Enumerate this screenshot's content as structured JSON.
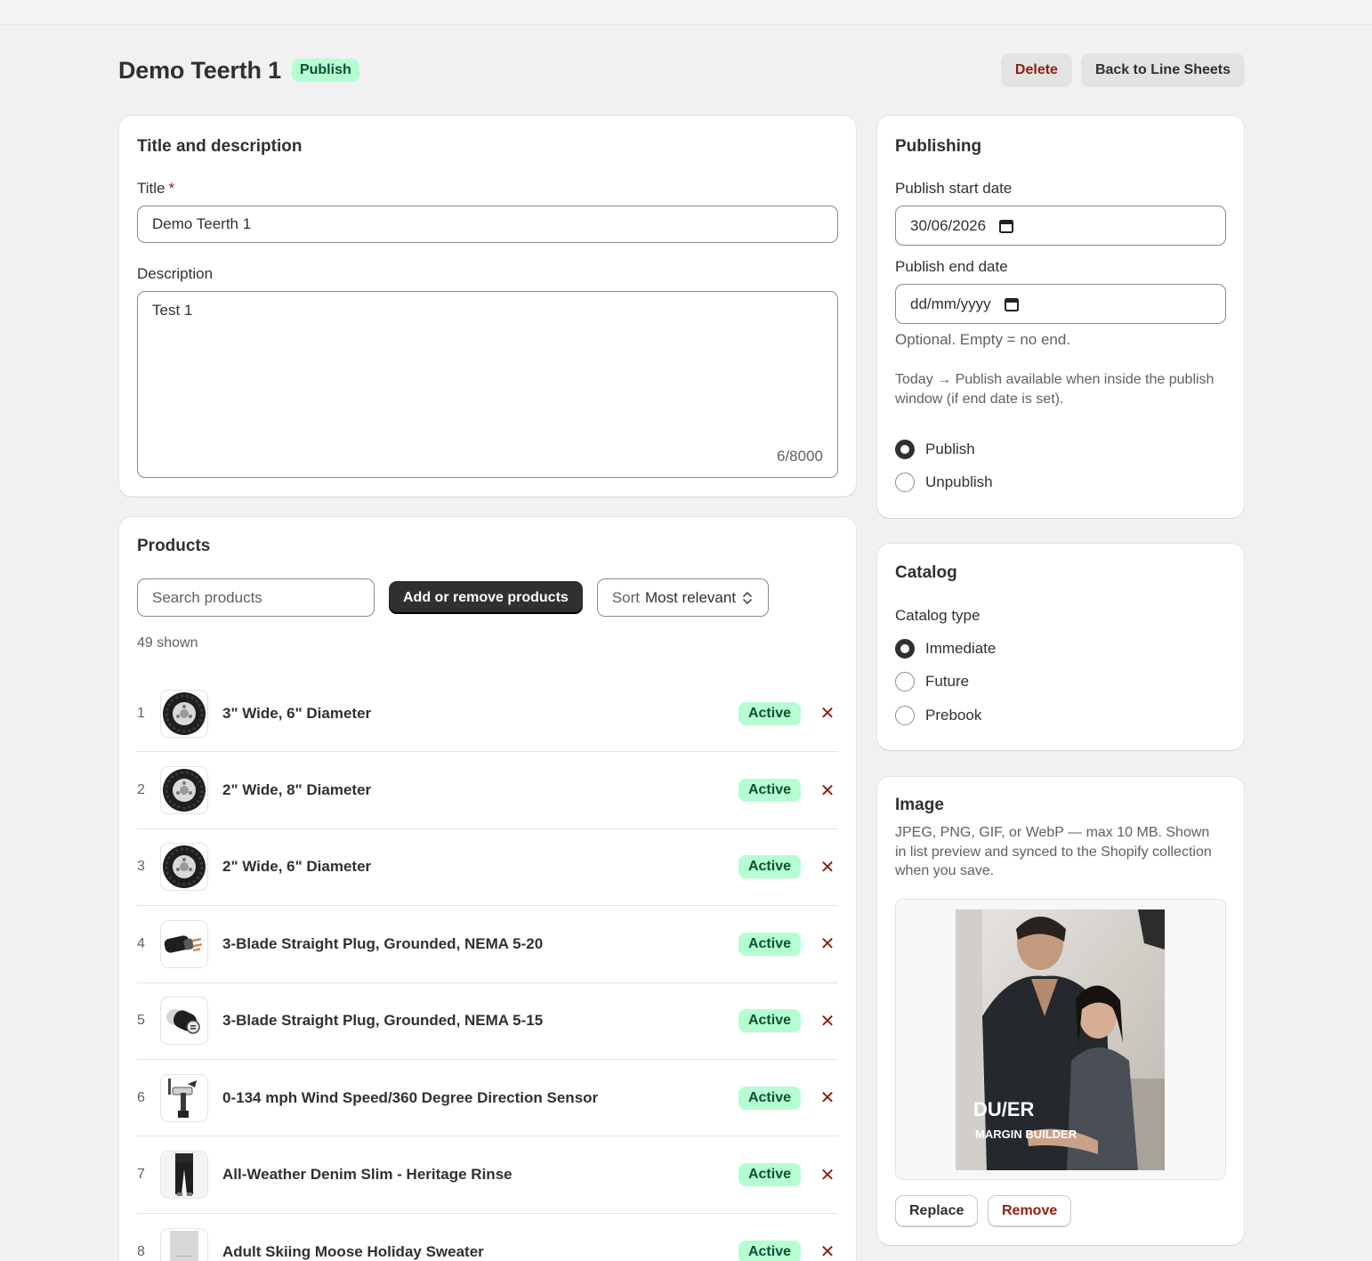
{
  "header": {
    "title": "Demo Teerth 1",
    "status_badge": "Publish",
    "delete_label": "Delete",
    "back_label": "Back to Line Sheets"
  },
  "title_description": {
    "heading": "Title and description",
    "title_label": "Title",
    "required_mark": "*",
    "title_value": "Demo Teerth 1",
    "description_label": "Description",
    "description_value": "Test 1",
    "char_count": "6/8000"
  },
  "products": {
    "heading": "Products",
    "search_placeholder": "Search products",
    "add_remove_label": "Add or remove products",
    "sort_prefix": "Sort",
    "sort_value": "Most relevant",
    "shown_count": "49 shown",
    "items": [
      {
        "num": "1",
        "name": "3\" Wide, 6\" Diameter",
        "status": "Active",
        "thumb": "tire-icon"
      },
      {
        "num": "2",
        "name": "2\" Wide, 8\" Diameter",
        "status": "Active",
        "thumb": "tire-icon"
      },
      {
        "num": "3",
        "name": "2\" Wide, 6\" Diameter",
        "status": "Active",
        "thumb": "tire-icon"
      },
      {
        "num": "4",
        "name": "3-Blade Straight Plug, Grounded, NEMA 5-20",
        "status": "Active",
        "thumb": "plug-icon"
      },
      {
        "num": "5",
        "name": "3-Blade Straight Plug, Grounded, NEMA 5-15",
        "status": "Active",
        "thumb": "plug-icon"
      },
      {
        "num": "6",
        "name": "0-134 mph Wind Speed/360 Degree Direction Sensor",
        "status": "Active",
        "thumb": "sensor-icon"
      },
      {
        "num": "7",
        "name": "All-Weather Denim Slim - Heritage Rinse",
        "status": "Active",
        "thumb": "jeans-icon"
      },
      {
        "num": "8",
        "name": "Adult Skiing Moose Holiday Sweater",
        "status": "Active",
        "thumb": "sweater-icon"
      }
    ],
    "remove_glyph": "✕"
  },
  "publishing": {
    "heading": "Publishing",
    "start_label": "Publish start date",
    "start_value": "30/06/2026",
    "end_label": "Publish end date",
    "end_value": "dd/mm/yyyy",
    "end_help": "Optional. Empty = no end.",
    "today_help": "Today → Publish available when inside the publish window (if end date is set).",
    "options": [
      "Publish",
      "Unpublish"
    ],
    "selected": "Publish"
  },
  "catalog": {
    "heading": "Catalog",
    "type_label": "Catalog type",
    "options": [
      "Immediate",
      "Future",
      "Prebook"
    ],
    "selected": "Immediate"
  },
  "image": {
    "heading": "Image",
    "help": "JPEG, PNG, GIF, or WebP — max 10 MB. Shown in list preview and synced to the Shopify collection when you save.",
    "brand_text": "DU/ER",
    "brand_subtext": "MARGIN BUILDER",
    "replace_label": "Replace",
    "remove_label": "Remove"
  },
  "colors": {
    "background": "#f1f1f1",
    "badge_green_bg": "#b4fed2",
    "badge_green_text": "#0c5132",
    "danger": "#8e1f0b",
    "primary_dark": "#303030"
  }
}
